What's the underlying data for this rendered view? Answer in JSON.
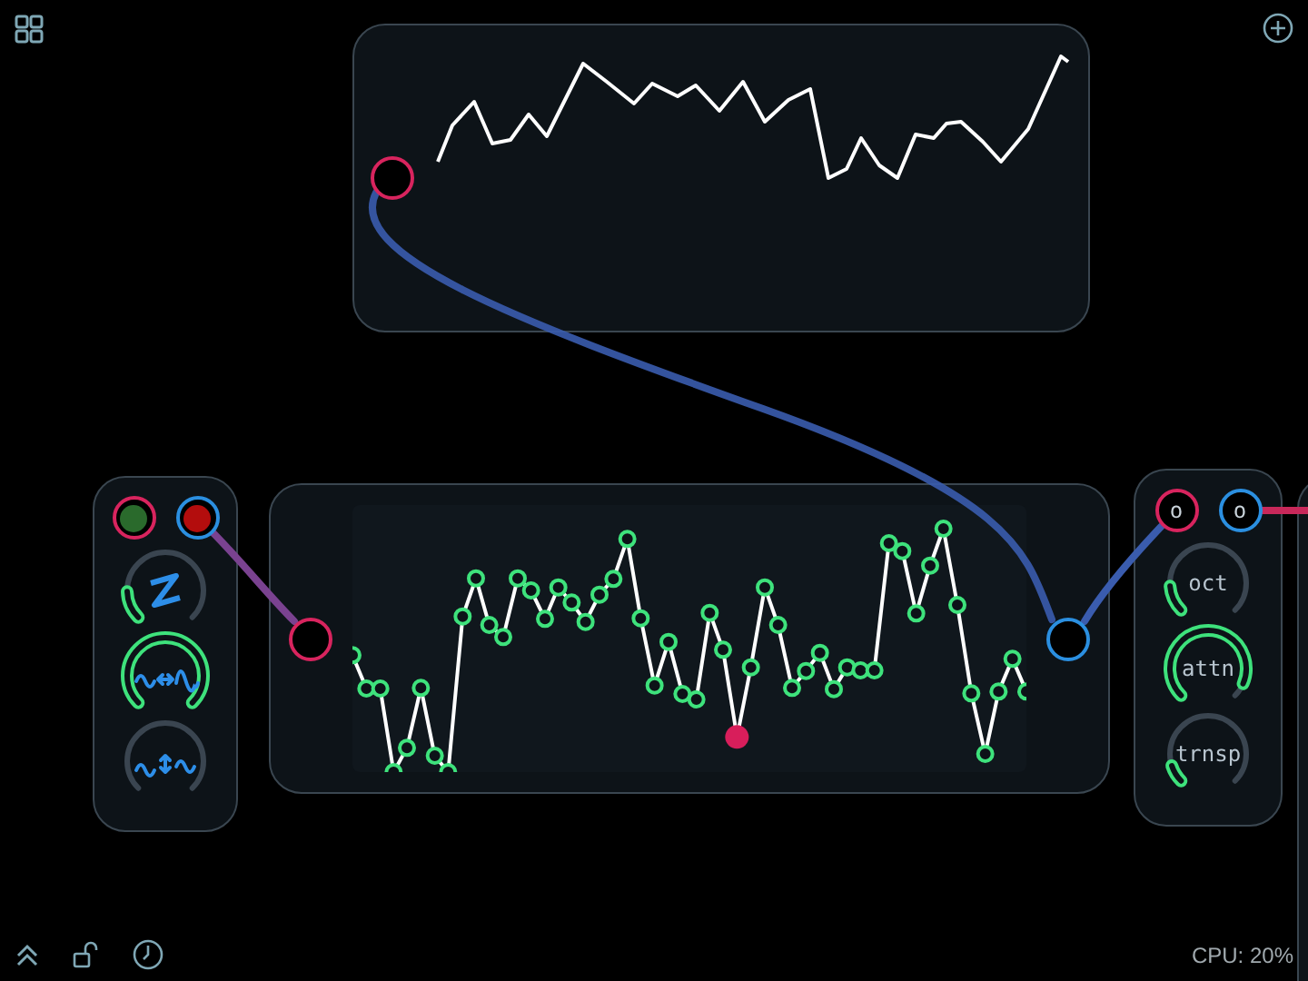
{
  "top_module": {
    "jacks": [
      {
        "kind": "input"
      }
    ]
  },
  "left_module": {
    "jacks": [
      {
        "kind": "input",
        "color": "#2a6a2c"
      },
      {
        "kind": "output",
        "color": "#b30d0d"
      }
    ]
  },
  "middle_module": {
    "jacks": [
      {
        "kind": "input"
      },
      {
        "kind": "output"
      }
    ]
  },
  "right_module": {
    "jacks": [
      {
        "kind": "input",
        "label": "o"
      },
      {
        "kind": "output",
        "label": "o"
      }
    ],
    "knobs": [
      {
        "label": "oct"
      },
      {
        "label": "attn"
      },
      {
        "label": "trnsp"
      }
    ]
  },
  "status_bar": {
    "cpu": "CPU: 20%"
  }
}
